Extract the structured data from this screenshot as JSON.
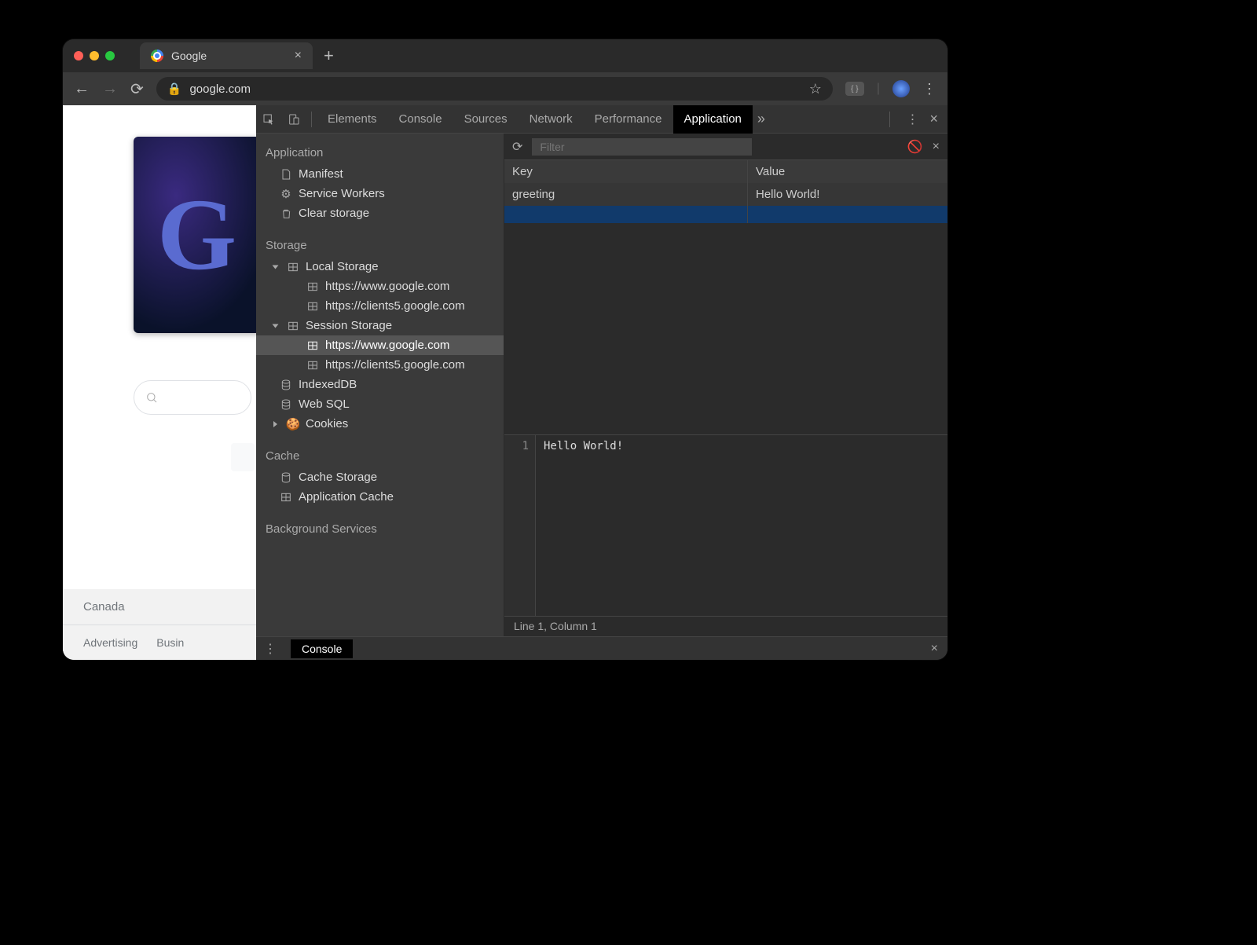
{
  "browser": {
    "tab_title": "Google",
    "url": "google.com",
    "page": {
      "footer_region": "Canada",
      "footer_links": [
        "Advertising",
        "Busin"
      ]
    }
  },
  "devtools": {
    "tabs": [
      "Elements",
      "Console",
      "Sources",
      "Network",
      "Performance",
      "Application"
    ],
    "active_tab": "Application",
    "sidebar": {
      "app_header": "Application",
      "app_items": [
        "Manifest",
        "Service Workers",
        "Clear storage"
      ],
      "storage_header": "Storage",
      "local_storage": "Local Storage",
      "local_items": [
        "https://www.google.com",
        "https://clients5.google.com"
      ],
      "session_storage": "Session Storage",
      "session_items": [
        "https://www.google.com",
        "https://clients5.google.com"
      ],
      "indexeddb": "IndexedDB",
      "websql": "Web SQL",
      "cookies": "Cookies",
      "cache_header": "Cache",
      "cache_items": [
        "Cache Storage",
        "Application Cache"
      ],
      "bg_header": "Background Services"
    },
    "storage_grid": {
      "filter_placeholder": "Filter",
      "key_header": "Key",
      "value_header": "Value",
      "rows": [
        {
          "key": "greeting",
          "value": "Hello World!"
        }
      ]
    },
    "preview_line_no": "1",
    "preview_text": "Hello World!",
    "status": "Line 1, Column 1",
    "drawer_tab": "Console"
  }
}
